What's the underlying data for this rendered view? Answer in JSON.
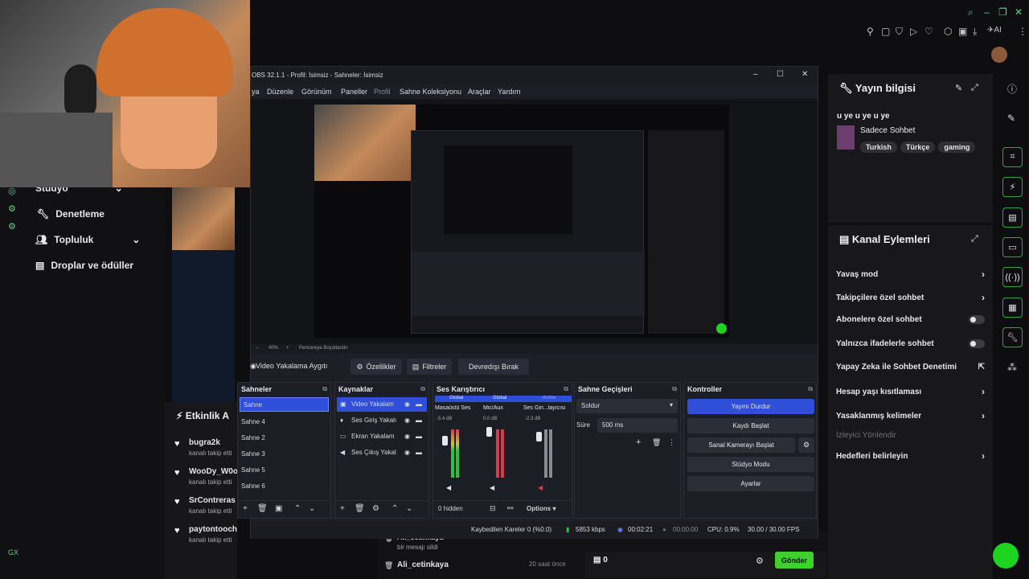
{
  "browser": {
    "ai_label": "AI"
  },
  "left_nav": {
    "items": [
      {
        "label": "Stüdyo"
      },
      {
        "label": "Denetleme"
      },
      {
        "label": "Topluluk"
      },
      {
        "label": "Droplar ve ödüller"
      }
    ],
    "gx_label": "GX"
  },
  "activity": {
    "title": "Etkinlik A",
    "events": [
      {
        "user": "bugra2k",
        "text": "kanalı takip etti"
      },
      {
        "user": "WooDy_W0o",
        "text": "kanalı takip etti"
      },
      {
        "user": "SrContreras",
        "text": "kanalı takip etti"
      },
      {
        "user": "paytontooch",
        "text": "kanalı takip etti"
      }
    ]
  },
  "stream_info": {
    "title": "Yayın bilgisi",
    "stream_title": "u ye u ye u ye",
    "category": "Sadece Sohbet",
    "tags": [
      "Turkish",
      "Türkçe",
      "gaming"
    ]
  },
  "channel_actions": {
    "title": "Kanal Eylemleri",
    "items": [
      {
        "label": "Yavaş mod",
        "control": "chevron"
      },
      {
        "label": "Takipçilere özel sohbet",
        "control": "chevron"
      },
      {
        "label": "Abonelere özel sohbet",
        "control": "toggle"
      },
      {
        "label": "Yalnızca ifadelerle sohbet",
        "control": "toggle"
      },
      {
        "label": "Yapay Zeka ile Sohbet Denetimi",
        "control": "external"
      },
      {
        "label": "Hesap yaşı kısıtlaması",
        "control": "chevron"
      },
      {
        "label": "Yasaklanmış kelimeler",
        "control": "chevron"
      },
      {
        "label": "İzleyici Yönlendir",
        "control": "none"
      },
      {
        "label": "Hedefleri belirleyin",
        "control": "chevron"
      }
    ]
  },
  "chat": {
    "messages": [
      {
        "user": "Ali_cetinkaya",
        "text": "bir mesajı sildi",
        "time": "20 saat önce"
      },
      {
        "user": "Ali_cetinkaya",
        "text": "",
        "time": "20 saat önce"
      }
    ],
    "points": "0",
    "send_label": "Gönder"
  },
  "obs": {
    "title": "OBS 32.1.1 - Profil: İsimsiz - Sahneler: İsimsiz",
    "menu": [
      "ya",
      "Düzenle",
      "Görünüm",
      "Paneller",
      "Profil",
      "Sahne Koleksiyonu",
      "Araçlar",
      "Yardım"
    ],
    "preview_status": "40%",
    "preview_fit": "Pencereye Boyutlandır",
    "source_label": "Video Yakalama Aygıtı",
    "properties_label": "Özellikler",
    "filters_label": "Filtreler",
    "deactivate_label": "Devredışı Bırak",
    "scenes": {
      "title": "Sahneler",
      "items": [
        "Sahne",
        "Sahne 4",
        "Sahne 2",
        "Sahne 3",
        "Sahne 5",
        "Sahne 6"
      ]
    },
    "sources": {
      "title": "Kaynaklar",
      "items": [
        "Video Yakalam",
        "Ses Giriş Yakalı",
        "Ekran Yakalam",
        "Ses Çıkış Yakal"
      ]
    },
    "mixer": {
      "title": "Ses Karıştırıcı",
      "channels": [
        {
          "badge": "Global",
          "name": "Masaüstü Ses",
          "db": "-5.4 dB"
        },
        {
          "badge": "Global",
          "name": "Mic/Aux",
          "db": "0.0 dB"
        },
        {
          "badge": "Active",
          "name": "Ses Giri...layıcısı",
          "db": "-2.3 dB"
        }
      ],
      "hidden": "0 hidden",
      "options": "Options"
    },
    "transitions": {
      "title": "Sahne Geçişleri",
      "type": "Soldur",
      "duration_label": "Süre",
      "duration": "500 ms"
    },
    "controls": {
      "title": "Kontroller",
      "buttons": [
        "Yayını Durdur",
        "Kaydı Başlat",
        "Sanal Kamerayı Başlat",
        "Stüdyo Modu",
        "Ayarlar"
      ]
    },
    "status": {
      "dropped": "Kaybedilen Kareler 0 (%0.0)",
      "bitrate": "5853 kbps",
      "live_time": "00:02:21",
      "rec_time": "00:00:00",
      "cpu": "CPU: 0.9%",
      "fps": "30.00 / 30.00 FPS"
    }
  },
  "colors": {
    "accent_green": "#2ea44f",
    "obs_blue": "#2f4fd8",
    "send_green": "#3fcf2f"
  }
}
